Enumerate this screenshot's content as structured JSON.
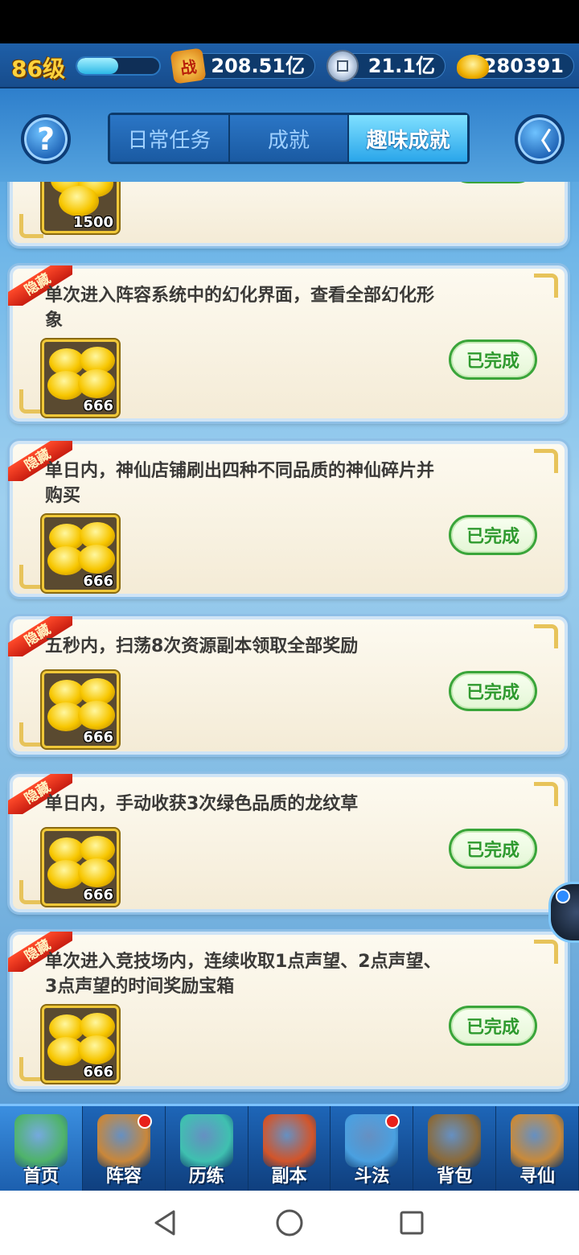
{
  "topbar": {
    "level": "86级",
    "exp_fraction": 0.5,
    "power_icon_char": "战",
    "power": "208.51亿",
    "coins": "21.1亿",
    "ingots": "280391"
  },
  "header": {
    "help_char": "?",
    "back_char": "〈",
    "tabs": [
      {
        "label": "日常任务",
        "active": false
      },
      {
        "label": "成就",
        "active": false
      },
      {
        "label": "趣味成就",
        "active": true
      }
    ]
  },
  "hidden_tag": "隐藏",
  "done_label": "已完成",
  "achievements": [
    {
      "text": "",
      "reward_qty": "1500",
      "hidden": false
    },
    {
      "text": "单次进入阵容系统中的幻化界面，查看全部幻化形象",
      "reward_qty": "666",
      "hidden": true
    },
    {
      "text": "单日内，神仙店铺刷出四种不同品质的神仙碎片并购买",
      "reward_qty": "666",
      "hidden": true
    },
    {
      "text": "五秒内，扫荡8次资源副本领取全部奖励",
      "reward_qty": "666",
      "hidden": true
    },
    {
      "text": "单日内，手动收获3次绿色品质的龙纹草",
      "reward_qty": "666",
      "hidden": true
    },
    {
      "text": "单次进入竞技场内，连续收取1点声望、2点声望、3点声望的时间奖励宝箱",
      "reward_qty": "666",
      "hidden": true
    }
  ],
  "bottom_nav": [
    {
      "label": "首页",
      "badge": false,
      "color": "#4fb36a"
    },
    {
      "label": "阵容",
      "badge": true,
      "color": "#c9873a"
    },
    {
      "label": "历练",
      "badge": false,
      "color": "#3fc0b0"
    },
    {
      "label": "副本",
      "badge": false,
      "color": "#d2552a"
    },
    {
      "label": "斗法",
      "badge": true,
      "color": "#4aa0e0"
    },
    {
      "label": "背包",
      "badge": false,
      "color": "#8a6a3a"
    },
    {
      "label": "寻仙",
      "badge": false,
      "color": "#c98a3a"
    }
  ]
}
